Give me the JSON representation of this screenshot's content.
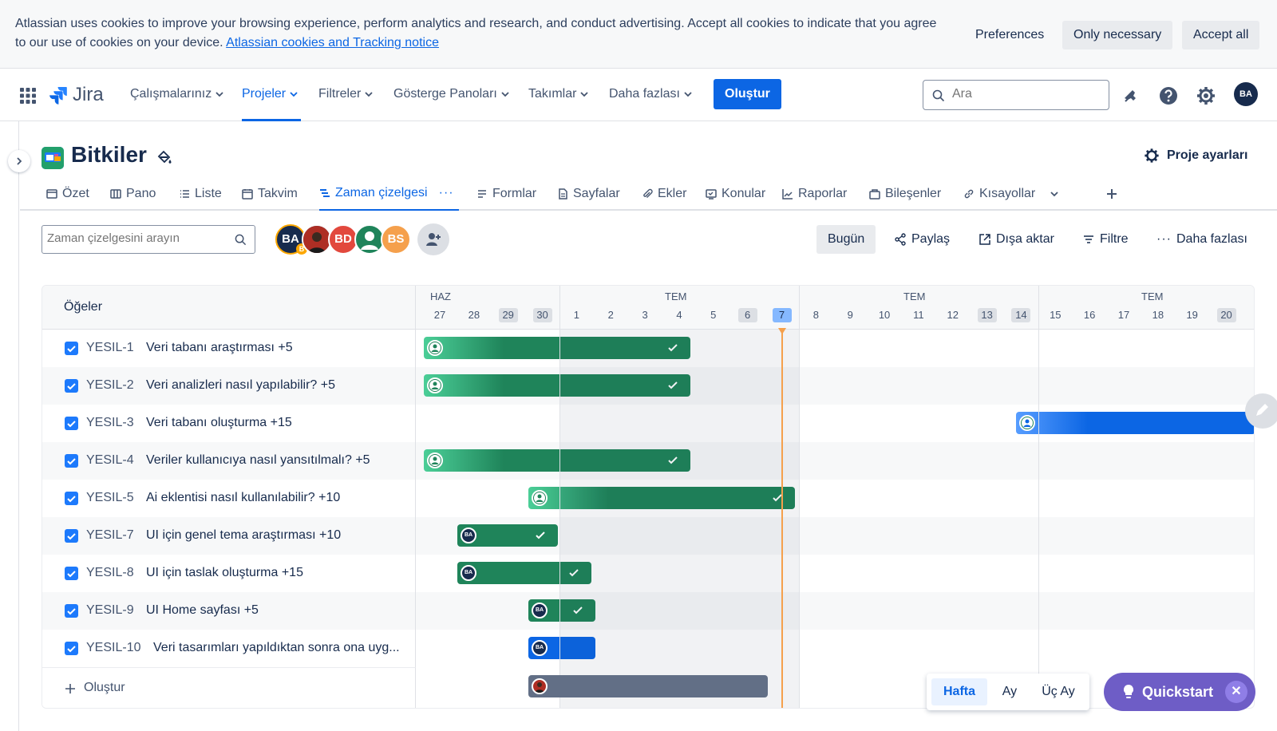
{
  "cookie_banner": {
    "text": "Atlassian uses cookies to improve your browsing experience, perform analytics and research, and conduct advertising. Accept all cookies to indicate that you agree to our use of cookies on your device.",
    "link": "Atlassian cookies and Tracking notice",
    "preferences": "Preferences",
    "only_necessary": "Only necessary",
    "accept_all": "Accept all"
  },
  "topnav": {
    "app_name": "Jira",
    "items": [
      "Çalışmalarınız",
      "Projeler",
      "Filtreler",
      "Gösterge Panoları",
      "Takımlar",
      "Daha fazlası"
    ],
    "active_item": "Projeler",
    "create": "Oluştur",
    "search_placeholder": "Ara",
    "user_initials": "BA"
  },
  "project": {
    "name": "Bitkiler",
    "settings": "Proje ayarları"
  },
  "tabs": [
    "Özet",
    "Pano",
    "Liste",
    "Takvim",
    "Zaman çizelgesi",
    "Formlar",
    "Sayfalar",
    "Ekler",
    "Konular",
    "Raporlar",
    "Bileşenler",
    "Kısayollar"
  ],
  "active_tab": "Zaman çizelgesi",
  "toolbar": {
    "search_placeholder": "Zaman çizelgesini arayın",
    "avatars": [
      "BA",
      "",
      "BD",
      "",
      "BS"
    ],
    "today": "Bugün",
    "share": "Paylaş",
    "export": "Dışa aktar",
    "filter": "Filtre",
    "more": "Daha fazlası"
  },
  "timeline": {
    "items_header": "Öğeler",
    "months": [
      "HAZ",
      "TEM",
      "TEM",
      "TEM"
    ],
    "days": [
      "27",
      "28",
      "29",
      "30",
      "1",
      "2",
      "3",
      "4",
      "5",
      "6",
      "7",
      "8",
      "9",
      "10",
      "11",
      "12",
      "13",
      "14",
      "15",
      "16",
      "17",
      "18",
      "19",
      "20",
      "2"
    ],
    "weekend_days": [
      "29",
      "30",
      "6",
      "13",
      "14",
      "20"
    ],
    "today_day": "7",
    "rows": [
      {
        "key": "YESIL-1",
        "summary": "Veri tabanı araştırması +5",
        "bar_color": "green",
        "done": true,
        "assignee": "unassigned"
      },
      {
        "key": "YESIL-2",
        "summary": "Veri analizleri nasıl yapılabilir? +5",
        "bar_color": "green",
        "done": true,
        "assignee": "unassigned"
      },
      {
        "key": "YESIL-3",
        "summary": "Veri tabanı oluşturma +15",
        "bar_color": "blue",
        "done": false,
        "assignee": "unassigned"
      },
      {
        "key": "YESIL-4",
        "summary": "Veriler kullanıcıya nasıl yansıtılmalı? +5",
        "bar_color": "green",
        "done": true,
        "assignee": "unassigned"
      },
      {
        "key": "YESIL-5",
        "summary": "Ai eklentisi nasıl kullanılabilir? +10",
        "bar_color": "green",
        "done": true,
        "assignee": "unassigned"
      },
      {
        "key": "YESIL-7",
        "summary": "UI için genel tema araştırması +10",
        "bar_color": "dgreen",
        "done": true,
        "assignee": "BA"
      },
      {
        "key": "YESIL-8",
        "summary": "UI için taslak oluşturma +15",
        "bar_color": "dgreen",
        "done": true,
        "assignee": "BA"
      },
      {
        "key": "YESIL-9",
        "summary": "UI Home sayfası +5",
        "bar_color": "dgreen",
        "done": true,
        "assignee": "BA"
      },
      {
        "key": "YESIL-10",
        "summary": "Veri tasarımları yapıldıktan sonra ona uyg...",
        "bar_color": "blue",
        "done": false,
        "assignee": "BA"
      }
    ],
    "create_label": "Oluştur"
  },
  "zoom": {
    "week": "Hafta",
    "month": "Ay",
    "quarter": "Üç Ay",
    "active": "Hafta"
  },
  "quickstart": "Quickstart",
  "colors": {
    "accent": "#0c66e4",
    "green": "#1f845a",
    "today_line": "#f5a04c",
    "quickstart": "#6e5dc6"
  }
}
